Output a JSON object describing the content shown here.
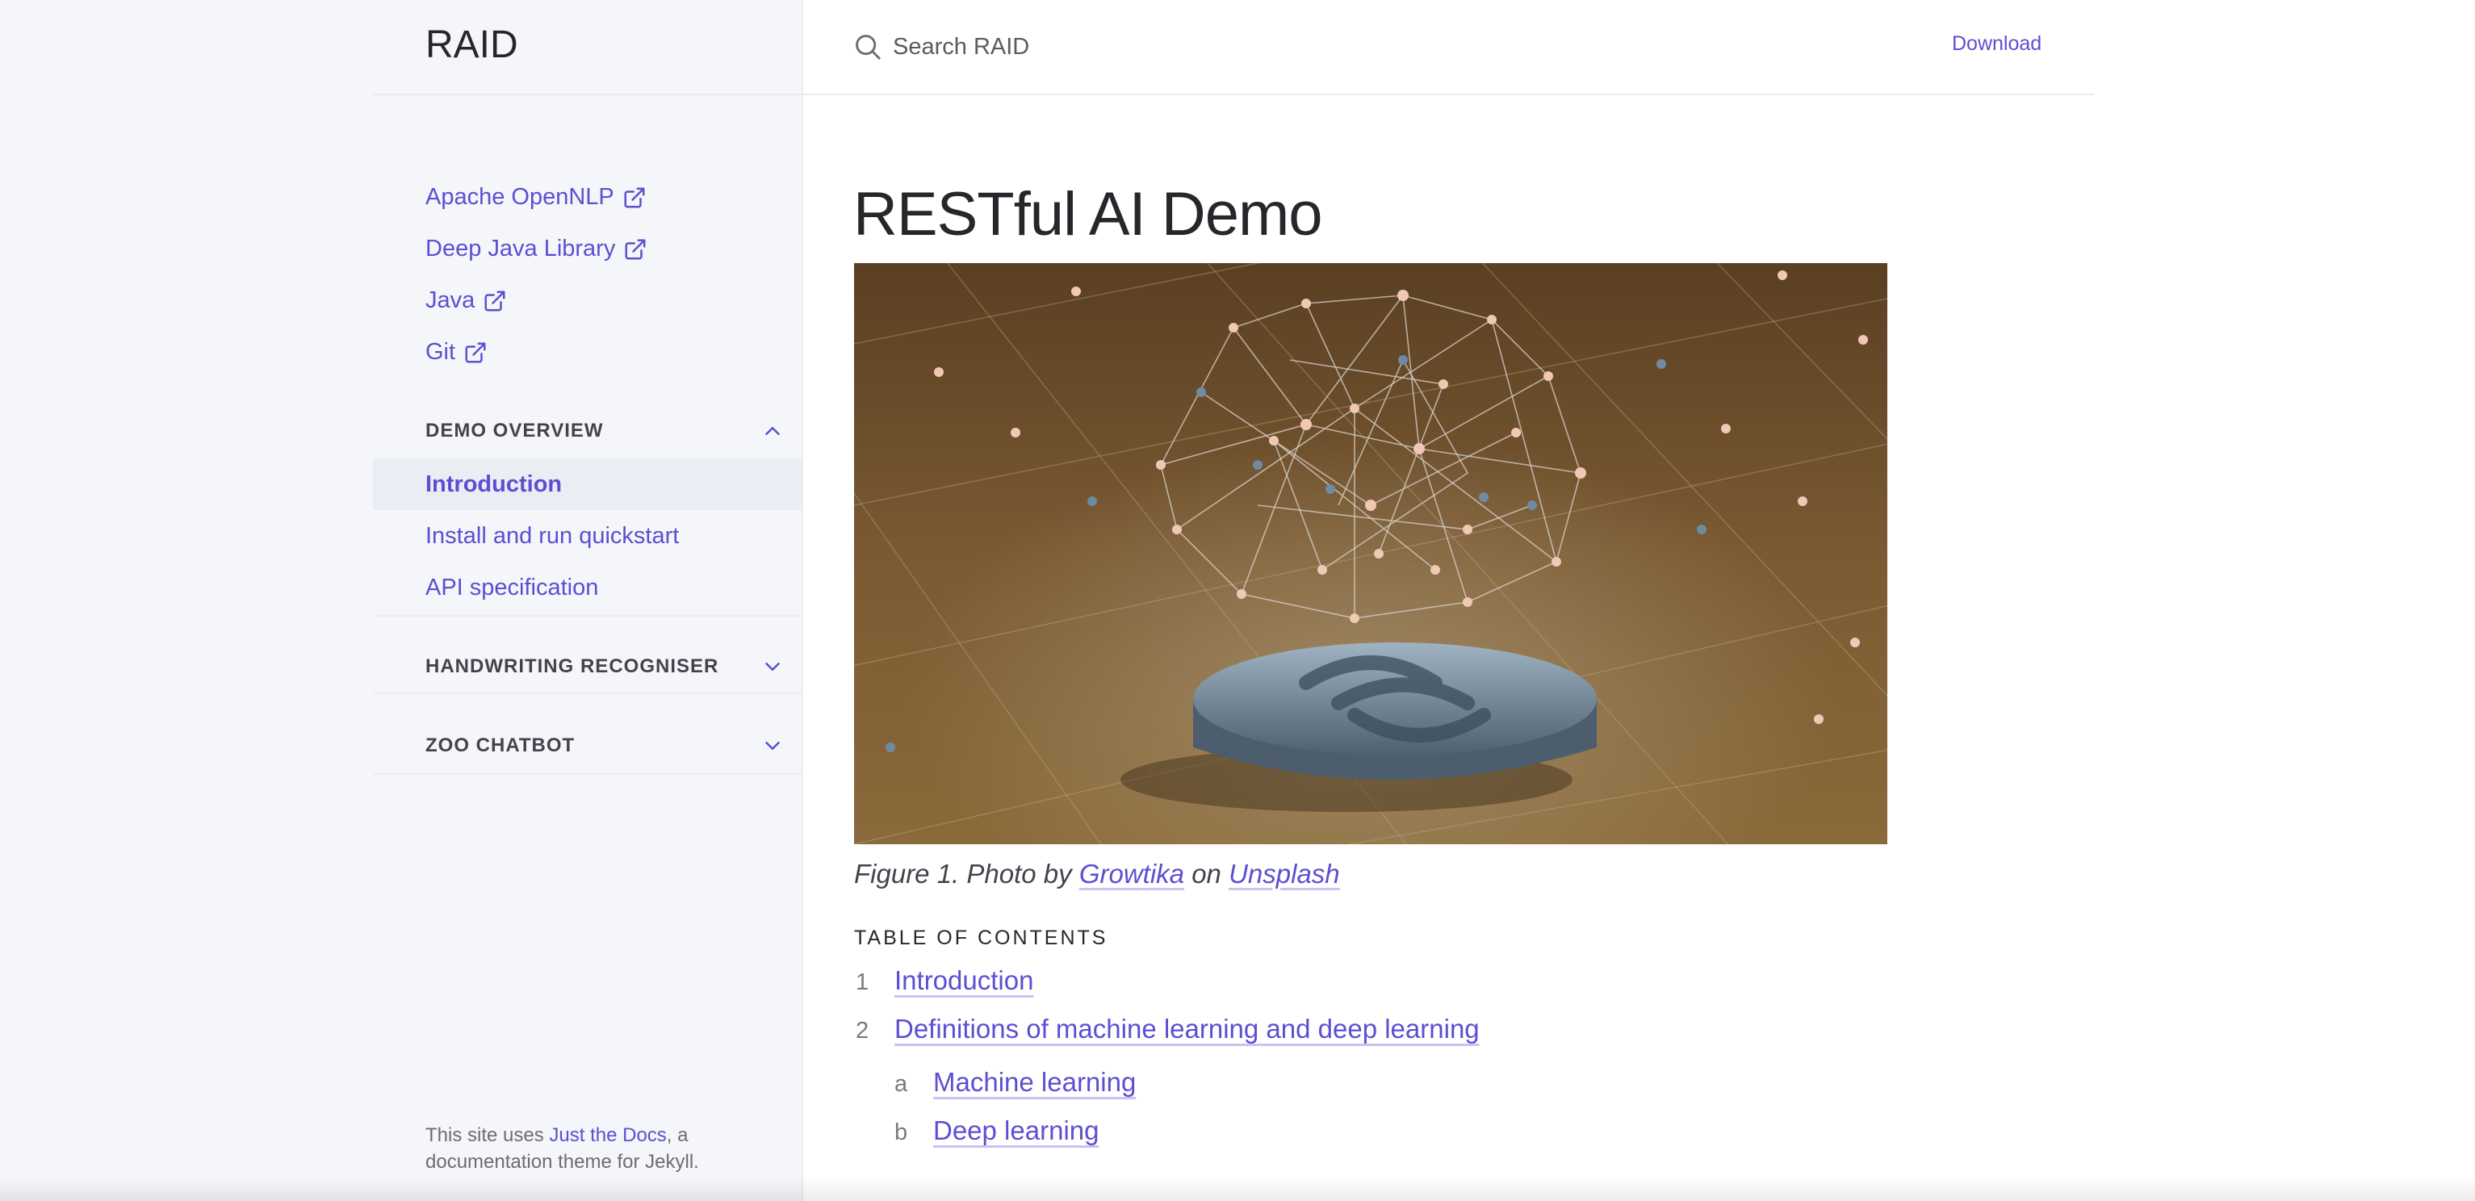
{
  "site": {
    "title": "RAID"
  },
  "header": {
    "search_placeholder": "Search RAID",
    "download_label": "Download"
  },
  "sidebar": {
    "external_links": [
      {
        "label": "Apache OpenNLP",
        "icon": "external-link-icon"
      },
      {
        "label": "Deep Java Library",
        "icon": "external-link-icon"
      },
      {
        "label": "Java",
        "icon": "external-link-icon"
      },
      {
        "label": "Git",
        "icon": "external-link-icon"
      }
    ],
    "sections": [
      {
        "title": "DEMO OVERVIEW",
        "expanded": true,
        "items": [
          "Introduction",
          "Install and run quickstart",
          "API specification"
        ],
        "active_item": "Introduction"
      },
      {
        "title": "HANDWRITING RECOGNISER",
        "expanded": false
      },
      {
        "title": "ZOO CHATBOT",
        "expanded": false
      }
    ],
    "footer": {
      "prefix": "This site uses ",
      "link": "Just the Docs",
      "suffix": ", a documentation theme for Jekyll."
    }
  },
  "main": {
    "title": "RESTful AI Demo",
    "figure": {
      "caption_prefix": "Figure 1. Photo by ",
      "author": "Growtika",
      "middle": " on ",
      "source": "Unsplash"
    },
    "toc": {
      "heading": "TABLE OF CONTENTS",
      "items": [
        {
          "num": "1",
          "label": "Introduction"
        },
        {
          "num": "2",
          "label": "Definitions of machine learning and deep learning"
        },
        {
          "num": "a",
          "label": "Machine learning"
        },
        {
          "num": "b",
          "label": "Deep learning"
        }
      ]
    }
  },
  "colors": {
    "link": "#5c4fd1",
    "sidebar_bg": "#f5f6fa",
    "main_bg": "#ffffff",
    "active_bg": "#ebedf5"
  }
}
